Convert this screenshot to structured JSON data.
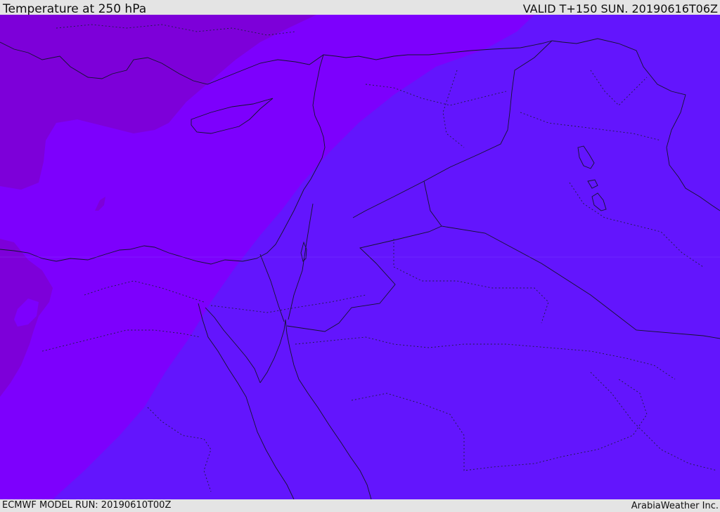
{
  "header": {
    "title": "Temperature at 250 hPa",
    "valid": "VALID T+150 SUN. 20190616T06Z"
  },
  "footer": {
    "model_run": "ECMWF MODEL RUN: 20190610T00Z",
    "credit": "ArabiaWeather Inc."
  },
  "colors": {
    "coldest_band": "#7d00d9",
    "cold_band": "#7d00fd",
    "mild_band": "#6315fd",
    "borders": "#1a1a3a"
  }
}
